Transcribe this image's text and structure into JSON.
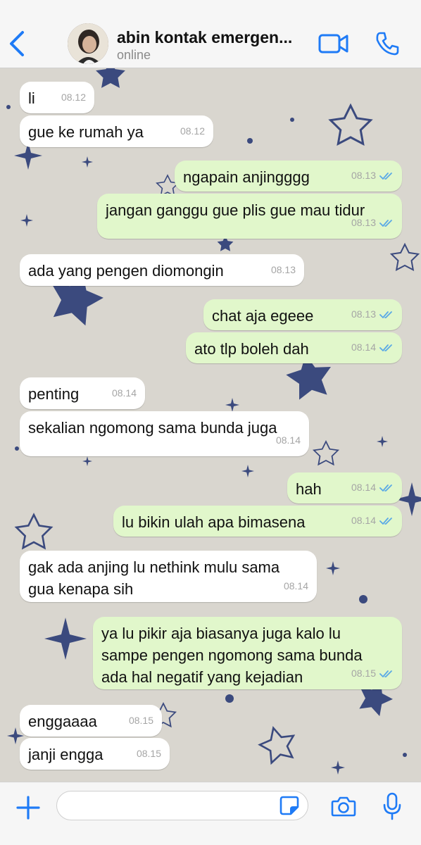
{
  "header": {
    "contact_name": "abin kontak emergen...",
    "status": "online"
  },
  "colors": {
    "accent": "#1f7bf6",
    "incoming_bubble": "#ffffff",
    "outgoing_bubble": "#e1f7cb",
    "read_ticks": "#5aa9e6",
    "wallpaper": "#d9d6cf",
    "star": "#3b4a7e"
  },
  "messages": [
    {
      "dir": "in",
      "text": "li",
      "time": "08.12"
    },
    {
      "dir": "in",
      "text": "gue ke rumah ya",
      "time": "08.12"
    },
    {
      "dir": "out",
      "text": "ngapain anjingggg",
      "time": "08.13"
    },
    {
      "dir": "out",
      "text": "jangan ganggu gue plis gue mau tidur",
      "time": "08.13"
    },
    {
      "dir": "in",
      "text": "ada yang pengen diomongin",
      "time": "08.13"
    },
    {
      "dir": "out",
      "text": "chat aja egeee",
      "time": "08.13"
    },
    {
      "dir": "out",
      "text": "ato tlp boleh dah",
      "time": "08.14"
    },
    {
      "dir": "in",
      "text": "penting",
      "time": "08.14"
    },
    {
      "dir": "in",
      "text": "sekalian ngomong sama bunda juga",
      "time": "08.14"
    },
    {
      "dir": "out",
      "text": "hah",
      "time": "08.14"
    },
    {
      "dir": "out",
      "text": "lu bikin ulah apa bimasena",
      "time": "08.14"
    },
    {
      "dir": "in",
      "text_lines": [
        "gak ada anjing lu nethink mulu sama",
        "gua kenapa sih"
      ],
      "time": "08.14"
    },
    {
      "dir": "out",
      "text_lines": [
        "ya lu pikir aja biasanya juga kalo lu",
        "sampe pengen ngomong sama bunda",
        "ada hal negatif yang kejadian"
      ],
      "time": "08.15"
    },
    {
      "dir": "in",
      "text": "enggaaaa",
      "time": "08.15"
    },
    {
      "dir": "in",
      "text": "janji engga",
      "time": "08.15"
    }
  ],
  "icons": {
    "back": "chevron-left-icon",
    "video": "video-camera-icon",
    "call": "phone-icon",
    "plus": "plus-icon",
    "sticker": "sticker-icon",
    "camera": "camera-icon",
    "mic": "microphone-icon"
  }
}
